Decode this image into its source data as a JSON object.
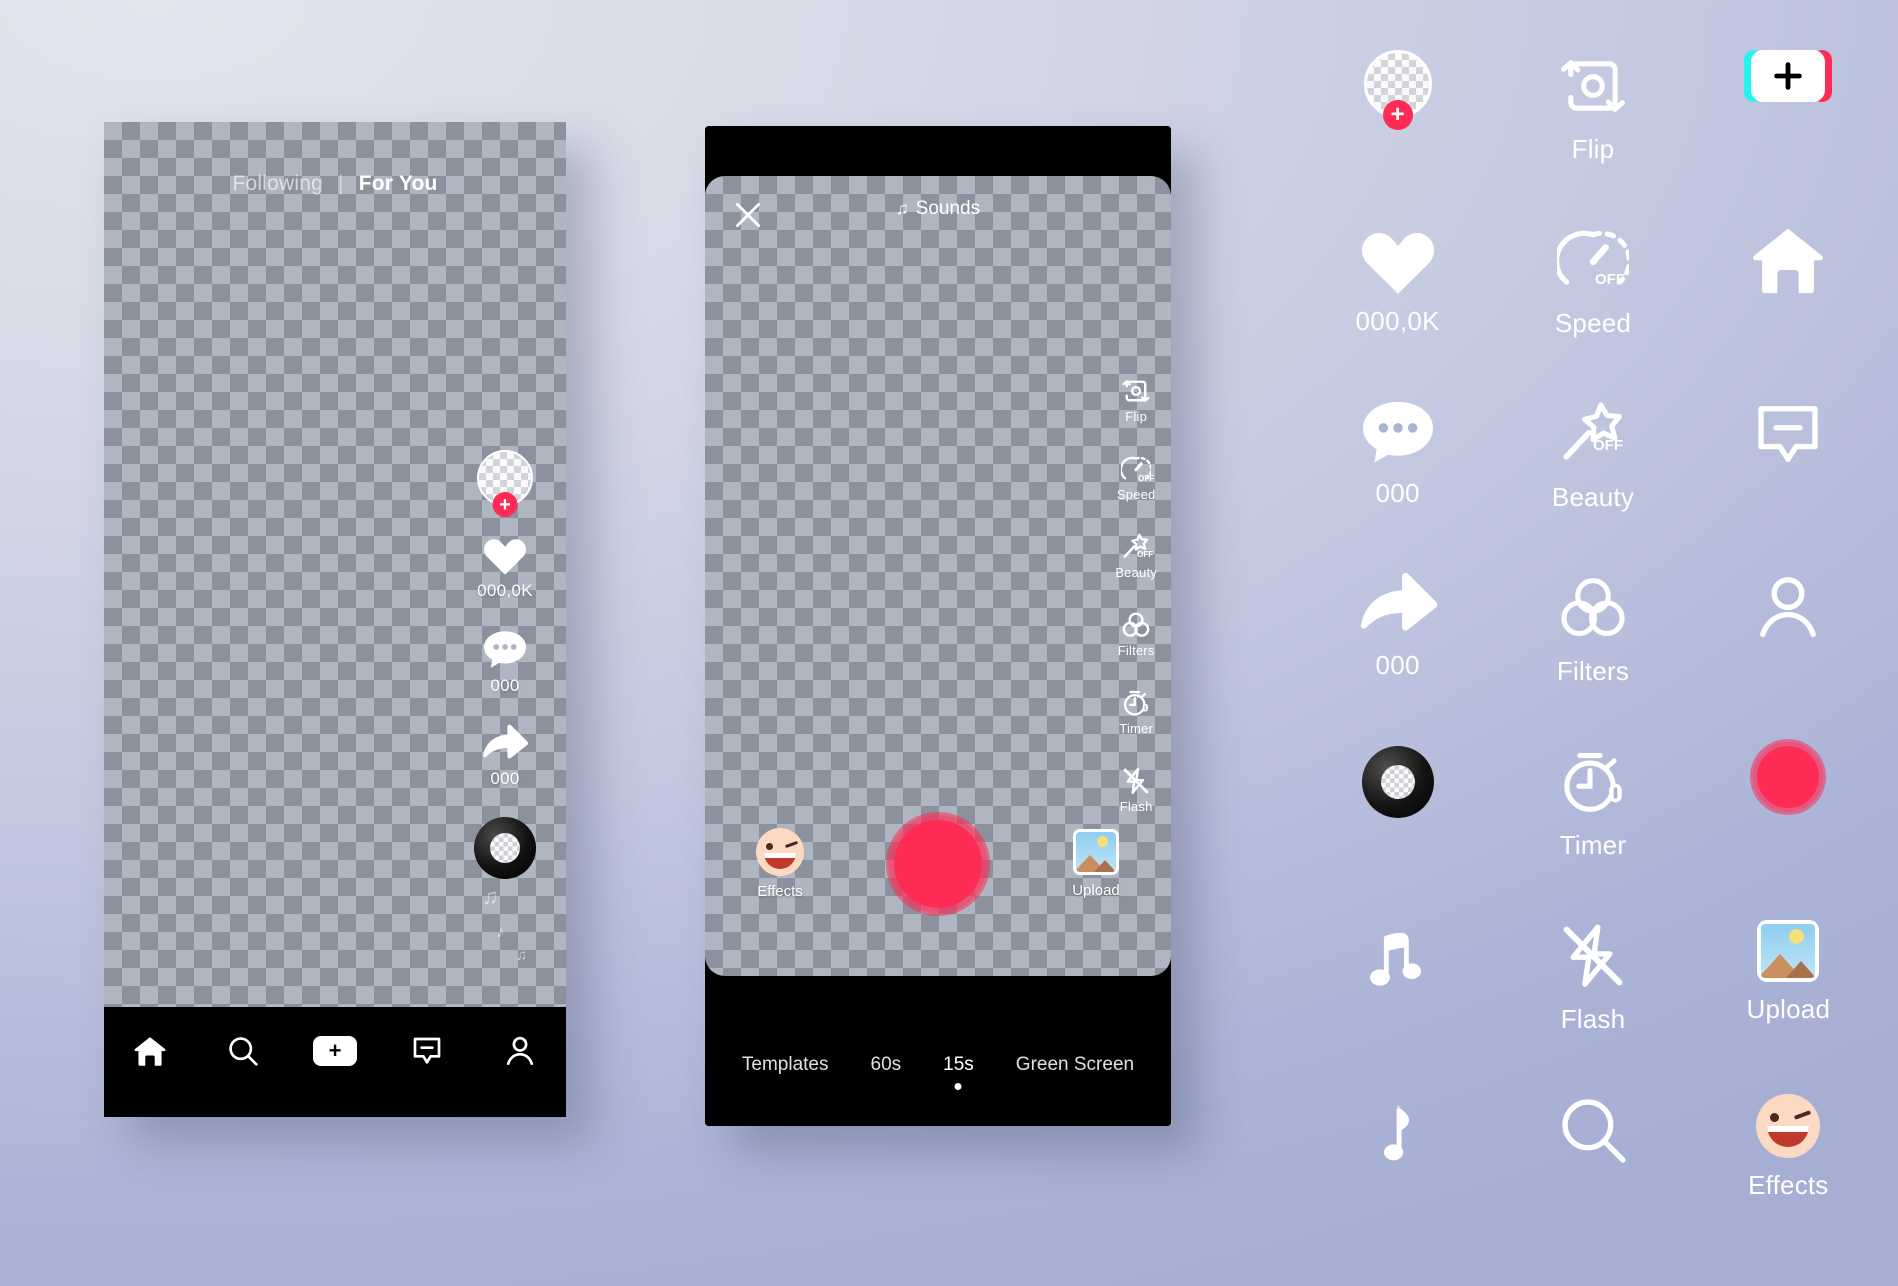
{
  "background": {
    "color_top": "#e2e4ee",
    "color_bottom": "#a6aed3"
  },
  "brand": {
    "accent_red": "#fe2c55",
    "accent_cyan": "#25f4ee"
  },
  "feed_screen": {
    "tabs": {
      "following": "Following",
      "separator": "|",
      "for_you": "For You"
    },
    "action_rail": [
      {
        "icon": "avatar-plus-icon",
        "label": ""
      },
      {
        "icon": "heart-icon",
        "label": "000,0K"
      },
      {
        "icon": "comment-icon",
        "label": "000"
      },
      {
        "icon": "share-icon",
        "label": "000"
      },
      {
        "icon": "music-disc-icon",
        "label": ""
      }
    ],
    "bottom_nav": [
      {
        "icon": "home-icon",
        "label": ""
      },
      {
        "icon": "search-icon",
        "label": ""
      },
      {
        "icon": "create-plus-icon",
        "label": "+"
      },
      {
        "icon": "inbox-icon",
        "label": ""
      },
      {
        "icon": "profile-icon",
        "label": ""
      }
    ]
  },
  "camera_screen": {
    "close_label": "×",
    "sounds_label": "Sounds",
    "sounds_note": "♫",
    "tools": [
      {
        "icon": "flip-icon",
        "label": "Flip",
        "badge": ""
      },
      {
        "icon": "speed-icon",
        "label": "Speed",
        "badge": "OFF"
      },
      {
        "icon": "beauty-icon",
        "label": "Beauty",
        "badge": "OFF"
      },
      {
        "icon": "filters-icon",
        "label": "Filters",
        "badge": ""
      },
      {
        "icon": "timer-icon",
        "label": "Timer",
        "badge": ""
      },
      {
        "icon": "flash-icon",
        "label": "Flash",
        "badge": ""
      }
    ],
    "shutter": {
      "effects_label": "Effects",
      "upload_label": "Upload",
      "record_label": ""
    },
    "modes": [
      {
        "label": "Templates",
        "active": false
      },
      {
        "label": "60s",
        "active": false
      },
      {
        "label": "15s",
        "active": true
      },
      {
        "label": "Green Screen",
        "active": false
      }
    ]
  },
  "icon_gallery": [
    {
      "icon": "avatar-plus-icon",
      "label": ""
    },
    {
      "icon": "flip-icon",
      "label": "Flip"
    },
    {
      "icon": "create-plus-icon",
      "label": ""
    },
    {
      "icon": "heart-icon",
      "label": "000,0K"
    },
    {
      "icon": "speed-icon",
      "label": "Speed"
    },
    {
      "icon": "home-icon",
      "label": ""
    },
    {
      "icon": "comment-icon",
      "label": "000"
    },
    {
      "icon": "beauty-icon",
      "label": "Beauty"
    },
    {
      "icon": "inbox-icon",
      "label": ""
    },
    {
      "icon": "share-icon",
      "label": "000"
    },
    {
      "icon": "filters-icon",
      "label": "Filters"
    },
    {
      "icon": "profile-icon",
      "label": ""
    },
    {
      "icon": "music-disc-icon",
      "label": ""
    },
    {
      "icon": "timer-icon",
      "label": "Timer"
    },
    {
      "icon": "record-icon",
      "label": ""
    },
    {
      "icon": "double-note-icon",
      "label": ""
    },
    {
      "icon": "flash-icon",
      "label": "Flash"
    },
    {
      "icon": "upload-icon",
      "label": "Upload"
    },
    {
      "icon": "single-note-icon",
      "label": ""
    },
    {
      "icon": "search-icon",
      "label": ""
    },
    {
      "icon": "effects-icon",
      "label": "Effects"
    }
  ]
}
